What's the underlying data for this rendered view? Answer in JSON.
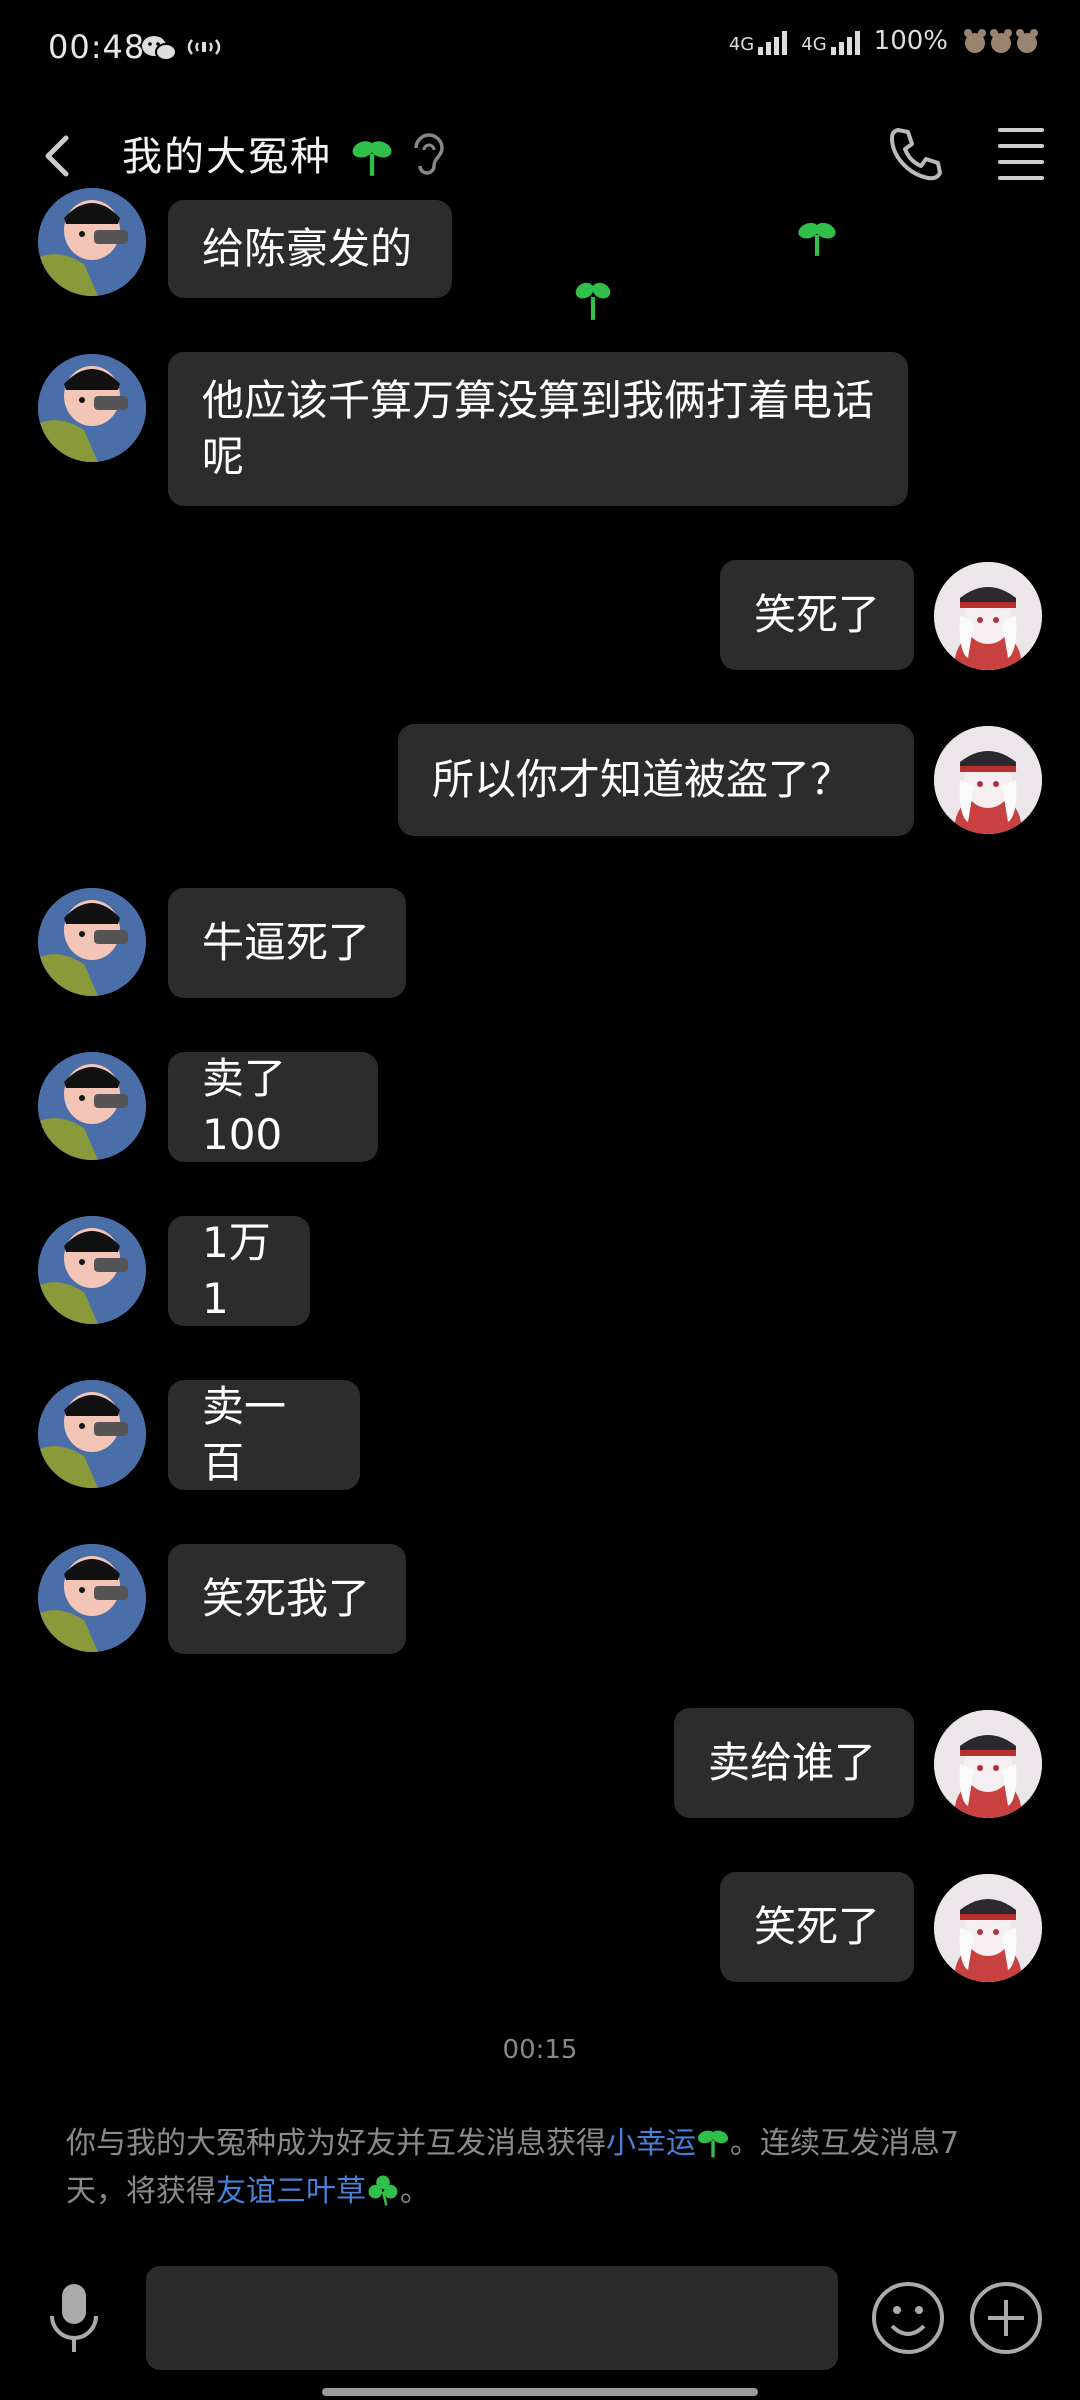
{
  "status": {
    "time": "00:48",
    "network1": "4G",
    "network2": "4G",
    "battery": "100%"
  },
  "header": {
    "title": "我的大冤种"
  },
  "messages": [
    {
      "side": "left",
      "text": "给陈豪发的"
    },
    {
      "side": "left",
      "text": "他应该千算万算没算到我俩打着电话呢"
    },
    {
      "side": "right",
      "text": "笑死了"
    },
    {
      "side": "right",
      "text": "所以你才知道被盗了？"
    },
    {
      "side": "left",
      "text": "牛逼死了"
    },
    {
      "side": "left",
      "text": "卖了100"
    },
    {
      "side": "left",
      "text": "1万1"
    },
    {
      "side": "left",
      "text": "卖一百"
    },
    {
      "side": "left",
      "text": "笑死我了"
    },
    {
      "side": "right",
      "text": "卖给谁了"
    },
    {
      "side": "right",
      "text": "笑死了"
    }
  ],
  "time_divider": "00:15",
  "notice": {
    "part1": "你与我的大冤种成为好友并互发消息获得",
    "link1": "小幸运",
    "part2": "。连续互发消息7天，将获得",
    "link2": "友谊三叶草",
    "part3": "。"
  },
  "colors": {
    "background": "#000000",
    "bubble": "#2c2c2c",
    "link": "#4a7fd6",
    "sprout": "#2fbf4a"
  }
}
